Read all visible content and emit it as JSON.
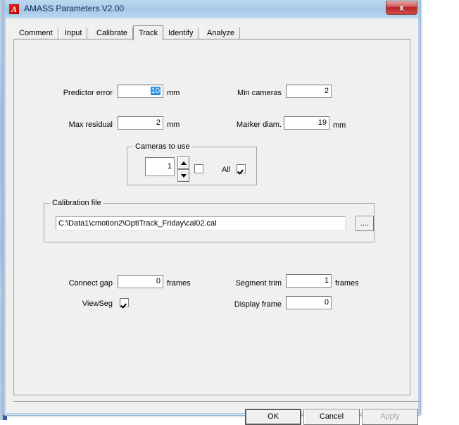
{
  "window": {
    "title": "AMASS Parameters V2.00",
    "icon": "amass-logo-icon",
    "icon_letter": "A",
    "close_label": "x",
    "ghost_text_1": "",
    "ghost_text_2": ""
  },
  "tabs": [
    {
      "label": "Comment",
      "selected": false
    },
    {
      "label": "Input",
      "selected": false
    },
    {
      "label": "Calibrate",
      "selected": false
    },
    {
      "label": "Track",
      "selected": true
    },
    {
      "label": "Identify",
      "selected": false
    },
    {
      "label": "Analyze",
      "selected": false
    }
  ],
  "track": {
    "predictor_error": {
      "label": "Predictor error",
      "value": "10",
      "unit": "mm",
      "selected": true
    },
    "max_residual": {
      "label": "Max residual",
      "value": "2",
      "unit": "mm"
    },
    "min_cameras": {
      "label": "Min cameras",
      "value": "2",
      "unit": ""
    },
    "marker_diam": {
      "label": "Marker diam.",
      "value": "19",
      "unit": "mm"
    },
    "cameras_to_use": {
      "title": "Cameras to use",
      "value": "1",
      "camera_checkbox_checked": false,
      "all_label": "All",
      "all_checked": true
    },
    "calibration_file": {
      "title": "Calibration file",
      "path": "C:\\Data1\\cmotion2\\OptiTrack_Friday\\cal02.cal",
      "browse_label": "...."
    },
    "connect_gap": {
      "label": "Connect gap",
      "value": "0",
      "unit": "frames"
    },
    "view_seg": {
      "label": "ViewSeg",
      "checked": true
    },
    "segment_trim": {
      "label": "Segment trim",
      "value": "1",
      "unit": "frames"
    },
    "display_frame": {
      "label": "Display frame",
      "value": "0",
      "unit": ""
    }
  },
  "buttons": {
    "ok": "OK",
    "cancel": "Cancel",
    "apply": "Apply"
  },
  "colors": {
    "accent_selection": "#2a8fe0",
    "titlebar": "#abcdea",
    "close_button": "#b72424",
    "dialog_face": "#f0f0f0"
  }
}
